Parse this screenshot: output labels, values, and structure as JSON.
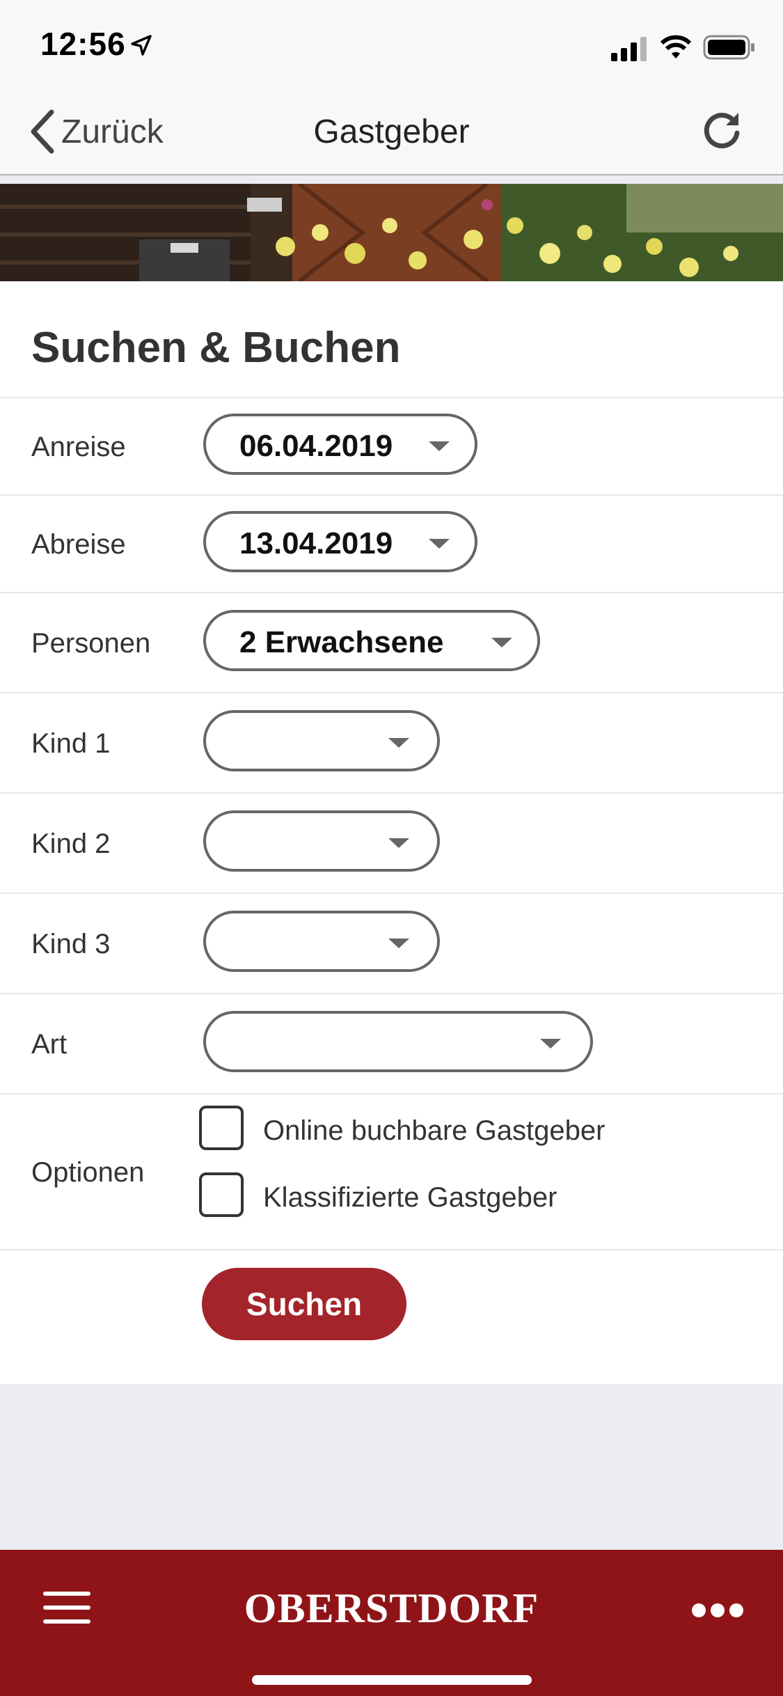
{
  "status_bar": {
    "time": "12:56"
  },
  "nav": {
    "back_label": "Zurück",
    "title": "Gastgeber"
  },
  "main": {
    "title": "Suchen & Buchen",
    "fields": [
      {
        "label": "Anreise",
        "value": "06.04.2019"
      },
      {
        "label": "Abreise",
        "value": "13.04.2019"
      },
      {
        "label": "Personen",
        "value": "2 Erwachsene"
      },
      {
        "label": "Kind 1",
        "value": ""
      },
      {
        "label": "Kind 2",
        "value": ""
      },
      {
        "label": "Kind 3",
        "value": ""
      },
      {
        "label": "Art",
        "value": ""
      }
    ],
    "options": {
      "label": "Optionen",
      "items": [
        {
          "label": "Online buchbare Gastgeber",
          "checked": false
        },
        {
          "label": "Klassifizierte Gastgeber",
          "checked": false
        }
      ]
    },
    "search_label": "Suchen"
  },
  "bottom_bar": {
    "brand": "OBERSTDORF"
  },
  "colors": {
    "accent": "#a3242a",
    "bottom_bar": "#8f1417"
  },
  "icons": [
    "location-arrow-icon",
    "cellular-signal-icon",
    "wifi-icon",
    "battery-icon",
    "chevron-left-icon",
    "refresh-icon",
    "caret-down-icon",
    "hamburger-menu-icon",
    "more-dots-icon"
  ]
}
